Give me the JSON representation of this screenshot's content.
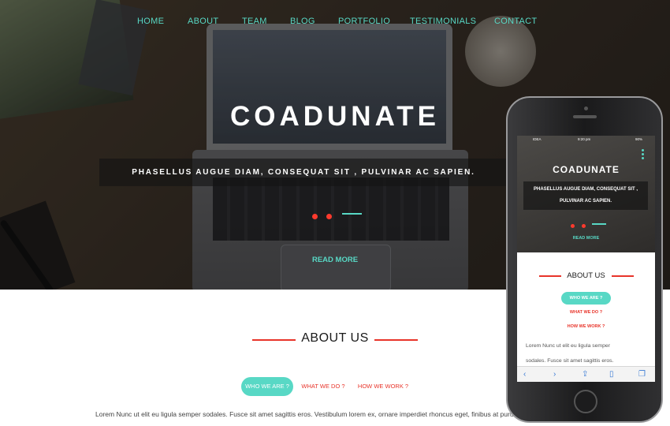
{
  "nav": {
    "items": [
      "HOME",
      "ABOUT",
      "TEAM",
      "BLOG",
      "PORTFOLIO",
      "TESTIMONIALS",
      "CONTACT"
    ]
  },
  "hero": {
    "title": "COADUNATE",
    "subtitle": "PHASELLUS AUGUE DIAM, CONSEQUAT SIT , PULVINAR AC SAPIEN.",
    "read_more": "READ MORE"
  },
  "about": {
    "title": "ABOUT US",
    "tabs": [
      "WHO WE ARE ?",
      "WHAT WE DO ?",
      "HOW WE WORK ?"
    ],
    "active_tab": 0,
    "text": "Lorem Nunc ut elit eu ligula semper sodales. Fusce sit amet sagittis eros. Vestibulum lorem ex, ornare imperdiet rhoncus eget, finibus at purus."
  },
  "phone": {
    "status": {
      "carrier": "IDEA",
      "time": "9:20 pm",
      "battery": "90%"
    },
    "hero_title": "COADUNATE",
    "hero_subtitle_lines": [
      "PHASELLUS AUGUE DIAM, CONSEQUAT SIT ,",
      "PULVINAR AC SAPIEN."
    ],
    "read_more": "READ MORE",
    "about_title": "ABOUT US",
    "tabs": [
      "WHO WE ARE ?",
      "WHAT WE DO ?",
      "HOW WE WORK ?"
    ],
    "text_lines": [
      "Lorem Nunc ut elit eu ligula semper",
      "sodales. Fusce sit amet sagittis eros."
    ],
    "toolbar_icons": [
      "back-icon",
      "forward-icon",
      "share-icon",
      "bookmarks-icon",
      "tabs-icon"
    ]
  },
  "colors": {
    "accent": "#58d8c5",
    "red": "#e8342a",
    "dot": "#ff3a2d"
  }
}
